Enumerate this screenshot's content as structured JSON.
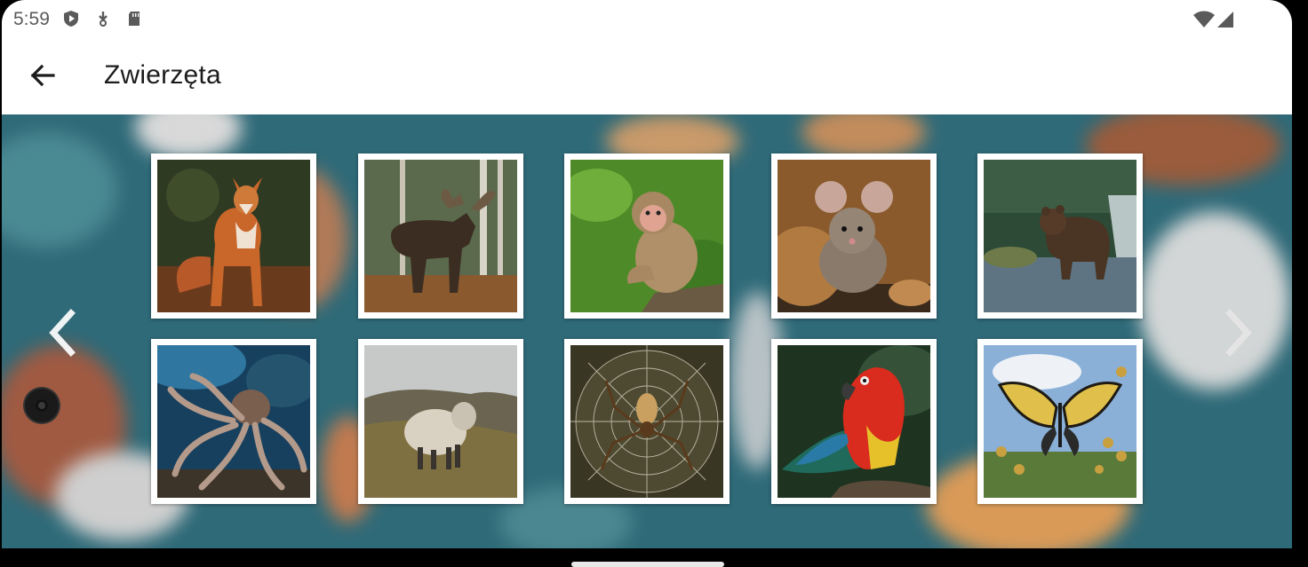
{
  "status_bar": {
    "time": "5:59"
  },
  "app_bar": {
    "title": "Zwierzęta"
  },
  "animals": [
    {
      "name": "fox"
    },
    {
      "name": "moose"
    },
    {
      "name": "monkey"
    },
    {
      "name": "mouse"
    },
    {
      "name": "bear"
    },
    {
      "name": "octopus"
    },
    {
      "name": "sheep"
    },
    {
      "name": "spider"
    },
    {
      "name": "parrot"
    },
    {
      "name": "butterfly"
    }
  ],
  "colors": {
    "background": "#2f6a78",
    "tile_border": "#ffffff",
    "app_bar": "#ffffff"
  }
}
